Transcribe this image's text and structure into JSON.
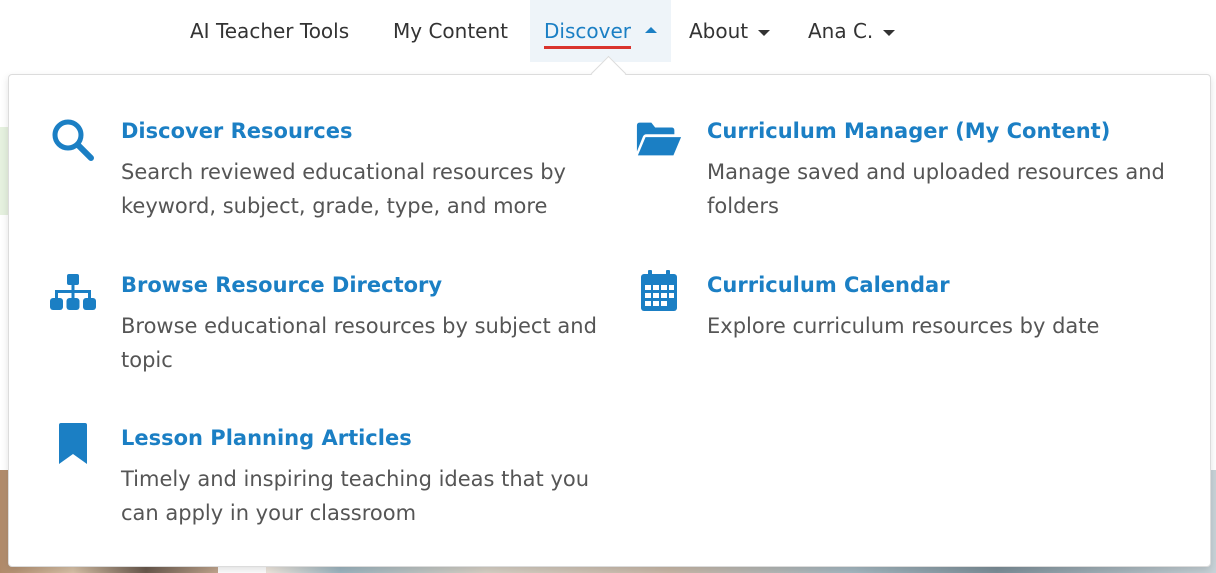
{
  "nav": {
    "items": [
      {
        "label": "AI Teacher Tools"
      },
      {
        "label": "My Content"
      },
      {
        "label": "Discover"
      },
      {
        "label": "About"
      },
      {
        "label": "Ana C."
      }
    ]
  },
  "dropdown": {
    "items": [
      {
        "icon": "search-icon",
        "title": "Discover Resources",
        "description": "Search reviewed educational resources by keyword, subject, grade, type, and more"
      },
      {
        "icon": "folder-open-icon",
        "title": "Curriculum Manager (My Content)",
        "description": "Manage saved and uploaded resources and folders"
      },
      {
        "icon": "sitemap-icon",
        "title": "Browse Resource Directory",
        "description": "Browse educational resources by subject and topic"
      },
      {
        "icon": "calendar-icon",
        "title": "Curriculum Calendar",
        "description": "Explore curriculum resources by date"
      },
      {
        "icon": "bookmark-icon",
        "title": "Lesson Planning Articles",
        "description": "Timely and inspiring teaching ideas that you can apply in your classroom"
      }
    ]
  },
  "colors": {
    "accent": "#1b7fc4",
    "active_underline": "#d9332d",
    "text": "#333333",
    "description": "#555555"
  }
}
